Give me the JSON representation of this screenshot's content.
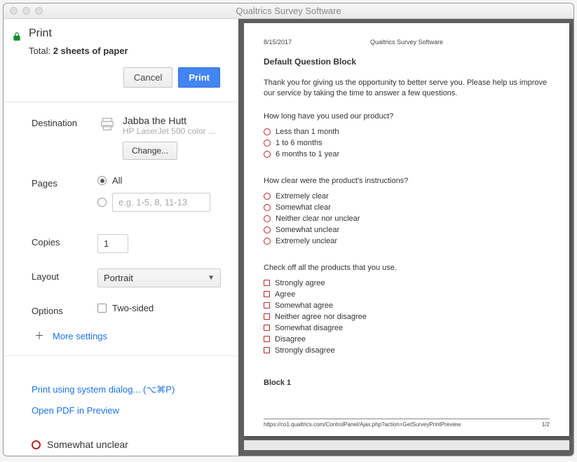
{
  "window": {
    "title": "Qualtrics Survey Software"
  },
  "print": {
    "heading": "Print",
    "total_prefix": "Total: ",
    "total_value": "2 sheets of paper",
    "cancel": "Cancel",
    "print_btn": "Print"
  },
  "destination": {
    "label": "Destination",
    "name": "Jabba the Hutt",
    "sub": "HP LaserJet 500 color ...",
    "change": "Change..."
  },
  "pages": {
    "label": "Pages",
    "all": "All",
    "placeholder": "e.g. 1-5, 8, 11-13"
  },
  "copies": {
    "label": "Copies",
    "value": "1"
  },
  "layout": {
    "label": "Layout",
    "value": "Portrait"
  },
  "options": {
    "label": "Options",
    "two_sided": "Two-sided"
  },
  "more": "More settings",
  "links": {
    "system": "Print using system dialog... (⌥⌘P)",
    "pdf": "Open PDF in Preview"
  },
  "preview": {
    "header_date": "8/15/2017",
    "header_title": "Qualtrics Survey Software",
    "doc_title": "Default Question Block",
    "intro": "Thank you for giving us the opportunity to better serve you. Please help us improve our service by taking the time to answer a few questions.",
    "q1": {
      "text": "How long have you used our product?",
      "opts": [
        "Less than 1 month",
        "1 to 6 months",
        "6 months to 1 year"
      ]
    },
    "q2": {
      "text": "How clear were the product's instructions?",
      "opts": [
        "Extremely clear",
        "Somewhat clear",
        "Neither clear nor unclear",
        "Somewhat unclear",
        "Extremely unclear"
      ]
    },
    "q3": {
      "text": "Check off all the products that you use.",
      "opts": [
        "Strongly agree",
        "Agree",
        "Somewhat agree",
        "Neither agree nor disagree",
        "Somewhat disagree",
        "Disagree",
        "Strongly disagree"
      ]
    },
    "block1": "Block 1",
    "footer_url": "https://co1.qualtrics.com/ControlPanel/Ajax.php?action=GetSurveyPrintPreview",
    "footer_page": "1/2"
  },
  "behind": {
    "opt": "Somewhat unclear"
  }
}
